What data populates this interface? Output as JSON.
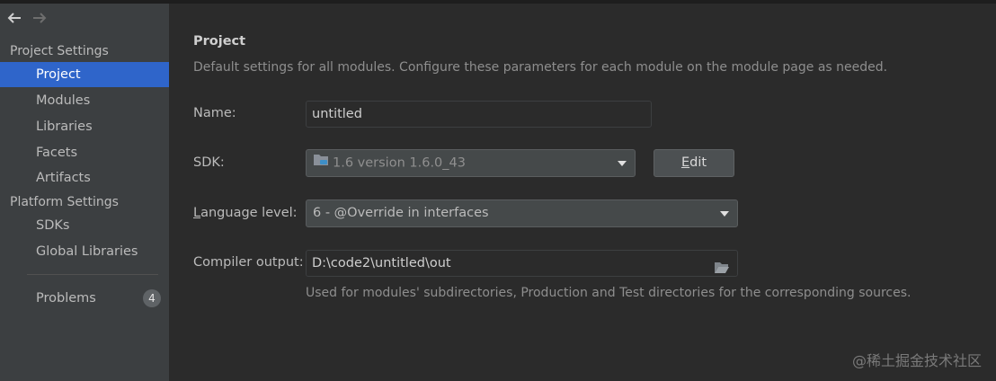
{
  "sidebar": {
    "sections": [
      {
        "title": "Project Settings",
        "items": [
          "Project",
          "Modules",
          "Libraries",
          "Facets",
          "Artifacts"
        ]
      },
      {
        "title": "Platform Settings",
        "items": [
          "SDKs",
          "Global Libraries"
        ]
      }
    ],
    "selected": "Project",
    "problems": {
      "label": "Problems",
      "count": "4"
    }
  },
  "main": {
    "title": "Project",
    "description": "Default settings for all modules. Configure these parameters for each module on the module page as needed.",
    "name": {
      "label": "Name:",
      "value": "untitled"
    },
    "sdk": {
      "label": "SDK:",
      "value": "1.6 version 1.6.0_43",
      "edit_label_prefix": "",
      "edit_mnemonic": "E",
      "edit_label_rest": "dit"
    },
    "language_level": {
      "label_mnemonic": "L",
      "label_rest": "anguage level:",
      "value": "6 - @Override in interfaces"
    },
    "compiler_output": {
      "label": "Compiler output:",
      "value": "D:\\code2\\untitled\\out",
      "hint": "Used for modules' subdirectories, Production and Test directories for the corresponding sources."
    }
  },
  "watermark": "@稀土掘金技术社区",
  "colors": {
    "selection": "#2f65ca",
    "sidebar_bg": "#3c3f41",
    "content_bg": "#2b2b2b"
  }
}
